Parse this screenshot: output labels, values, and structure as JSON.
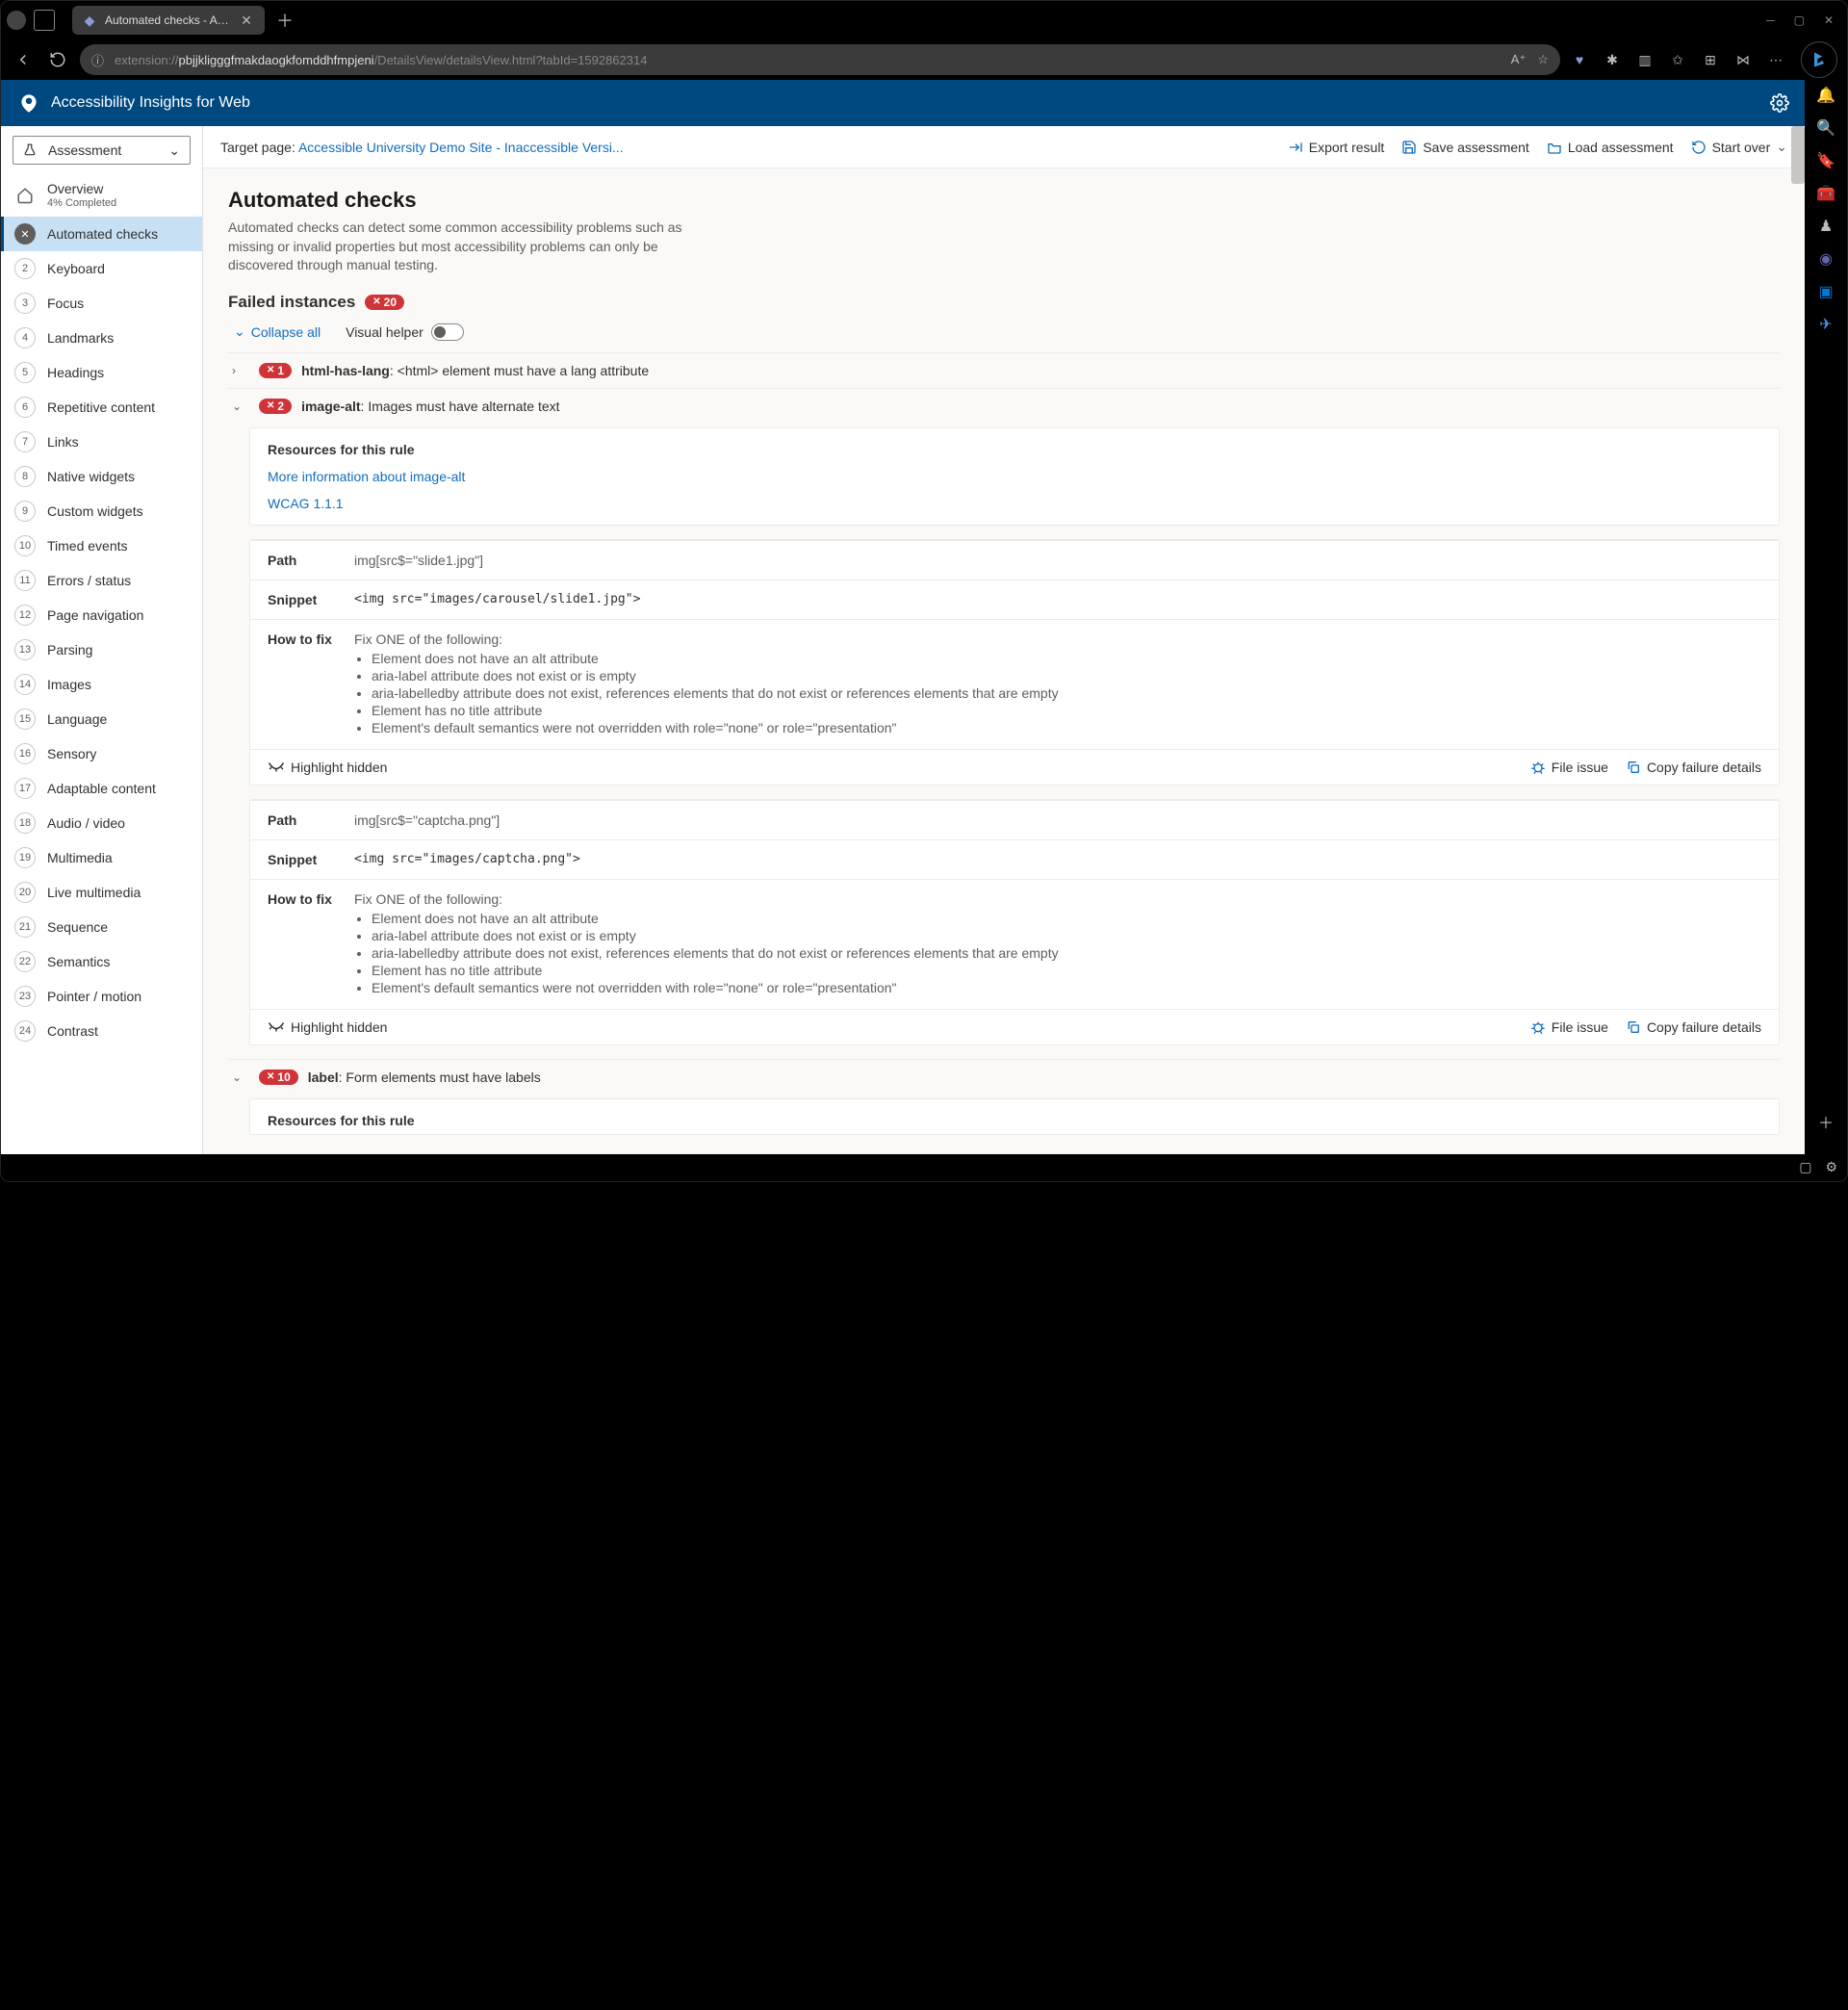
{
  "browser": {
    "tab_title": "Automated checks - Accessibility",
    "url_prefix": "extension://",
    "url_bold": "pbjjkligggfmakdaogkfomddhfmpjeni",
    "url_rest": "/DetailsView/detailsView.html?tabId=1592862314"
  },
  "header": {
    "title": "Accessibility Insights for Web"
  },
  "assessment_dd": "Assessment",
  "overview": {
    "label": "Overview",
    "sub": "4% Completed"
  },
  "nav": [
    {
      "n": "",
      "label": "Automated checks",
      "active": true,
      "icon": "x"
    },
    {
      "n": "2",
      "label": "Keyboard"
    },
    {
      "n": "3",
      "label": "Focus"
    },
    {
      "n": "4",
      "label": "Landmarks"
    },
    {
      "n": "5",
      "label": "Headings"
    },
    {
      "n": "6",
      "label": "Repetitive content"
    },
    {
      "n": "7",
      "label": "Links"
    },
    {
      "n": "8",
      "label": "Native widgets"
    },
    {
      "n": "9",
      "label": "Custom widgets"
    },
    {
      "n": "10",
      "label": "Timed events"
    },
    {
      "n": "11",
      "label": "Errors / status"
    },
    {
      "n": "12",
      "label": "Page navigation"
    },
    {
      "n": "13",
      "label": "Parsing"
    },
    {
      "n": "14",
      "label": "Images"
    },
    {
      "n": "15",
      "label": "Language"
    },
    {
      "n": "16",
      "label": "Sensory"
    },
    {
      "n": "17",
      "label": "Adaptable content"
    },
    {
      "n": "18",
      "label": "Audio / video"
    },
    {
      "n": "19",
      "label": "Multimedia"
    },
    {
      "n": "20",
      "label": "Live multimedia"
    },
    {
      "n": "21",
      "label": "Sequence"
    },
    {
      "n": "22",
      "label": "Semantics"
    },
    {
      "n": "23",
      "label": "Pointer / motion"
    },
    {
      "n": "24",
      "label": "Contrast"
    }
  ],
  "actionbar": {
    "target_label": "Target page: ",
    "target_link": "Accessible University Demo Site - Inaccessible Versi...",
    "export": "Export result",
    "save": "Save assessment",
    "load": "Load assessment",
    "start_over": "Start over"
  },
  "page": {
    "title": "Automated checks",
    "desc": "Automated checks can detect some common accessibility problems such as missing or invalid properties but most accessibility problems can only be discovered through manual testing.",
    "failed_heading": "Failed instances",
    "failed_count": "20",
    "collapse_all": "Collapse all",
    "visual_helper": "Visual helper"
  },
  "rule1": {
    "count": "1",
    "name": "html-has-lang",
    "msg": ": <html> element must have a lang attribute"
  },
  "rule2": {
    "count": "2",
    "name": "image-alt",
    "msg": ": Images must have alternate text",
    "resources_h": "Resources for this rule",
    "link1": "More information about image-alt",
    "link2": "WCAG 1.1.1",
    "labels": {
      "path": "Path",
      "snippet": "Snippet",
      "howto": "How to fix"
    },
    "howto_intro": "Fix ONE of the following:",
    "fixlist": [
      "Element does not have an alt attribute",
      "aria-label attribute does not exist or is empty",
      "aria-labelledby attribute does not exist, references elements that do not exist or references elements that are empty",
      "Element has no title attribute",
      "Element's default semantics were not overridden with role=\"none\" or role=\"presentation\""
    ],
    "inst1": {
      "path": "img[src$=\"slide1.jpg\"]",
      "snippet": "<img src=\"images/carousel/slide1.jpg\">"
    },
    "inst2": {
      "path": "img[src$=\"captcha.png\"]",
      "snippet": "<img src=\"images/captcha.png\">"
    },
    "foot": {
      "highlight": "Highlight hidden",
      "file": "File issue",
      "copy": "Copy failure details"
    }
  },
  "rule3": {
    "count": "10",
    "name": "label",
    "msg": ": Form elements must have labels",
    "resources_h": "Resources for this rule"
  }
}
